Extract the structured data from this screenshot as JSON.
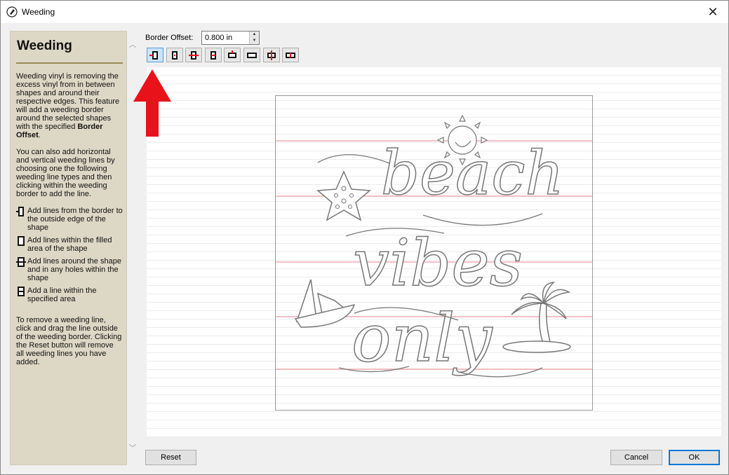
{
  "window": {
    "title": "Weeding"
  },
  "help": {
    "title": "Weeding",
    "para1_text": "Weeding vinyl is removing the excess vinyl from in between shapes and around their respective edges. This feature will add a weeding border around the selected shapes with the specified ",
    "para1_bold": "Border Offset",
    "para1_end": ".",
    "para2": "You can also add horizontal and vertical weeding lines by choosing one the following weeding line types and then clicking within the weeding border to add the line.",
    "legend": [
      "Add lines from the border to the outside edge of the shape",
      "Add lines within the filled area of the shape",
      "Add lines around the shape and in any holes within the shape",
      "Add a line within the specified area"
    ],
    "para3": "To remove a weeding line, click and drag the line outside of the weeding border. Clicking the Reset button will remove all weeding lines you have added."
  },
  "offset": {
    "label": "Border Offset:",
    "value": "0.800 in"
  },
  "toolbar": {
    "tools": [
      "border-to-outside-icon",
      "within-filled-icon",
      "around-shape-icon",
      "within-area-icon",
      "border-to-outside-horizontal-icon",
      "within-filled-horizontal-icon",
      "around-shape-horizontal-icon",
      "within-area-horizontal-icon"
    ]
  },
  "artwork": {
    "line1": "beach",
    "line2": "vibes",
    "line3": "only"
  },
  "buttons": {
    "reset": "Reset",
    "cancel": "Cancel",
    "ok": "OK"
  },
  "colors": {
    "annotation_arrow": "#e8121a",
    "weeding_line": "#f2aab0",
    "help_bg": "#ddd8c6",
    "ok_border": "#0078d7"
  }
}
